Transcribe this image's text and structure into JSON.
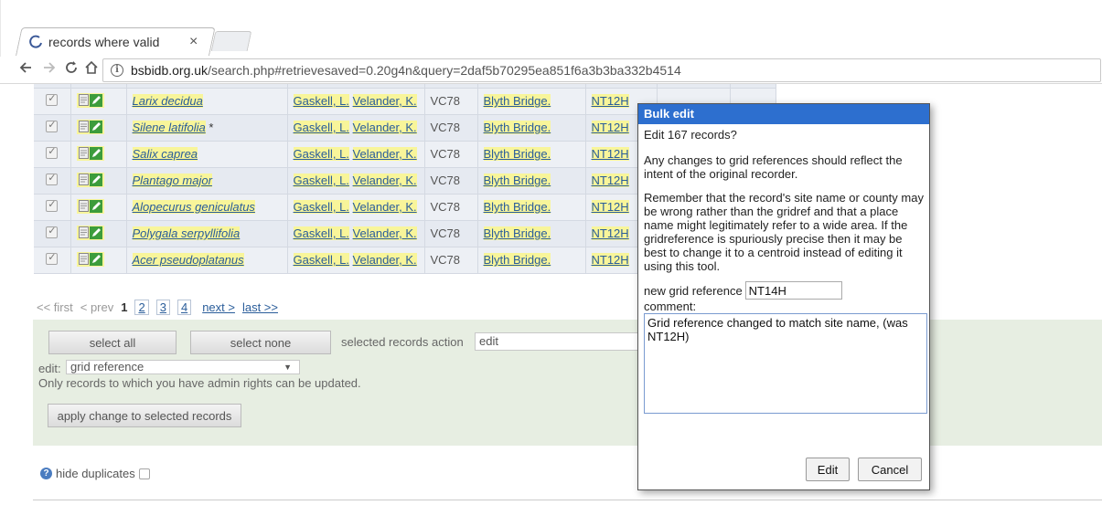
{
  "browser": {
    "tab_title": "records where valid",
    "tab_close": "×",
    "url_domain": "bsbidb.org.uk",
    "url_path": "/search.php#retrievesaved=0.20g4n&query=2daf5b70295ea851f6a3b3ba332b4514",
    "icons": {
      "back": "arrow-left",
      "forward": "arrow-right",
      "reload": "reload",
      "home": "home",
      "info": "info"
    }
  },
  "table": {
    "rows": [
      {
        "taxon": "Larix decidua",
        "marker": "",
        "recorder1": "Gaskell, L.",
        "recorder2": "Velander, K.",
        "vc": "VC78",
        "site": "Blyth Bridge.",
        "grid": "NT12H"
      },
      {
        "taxon": "Silene latifolia",
        "marker": "*",
        "recorder1": "Gaskell, L.",
        "recorder2": "Velander, K.",
        "vc": "VC78",
        "site": "Blyth Bridge.",
        "grid": "NT12H"
      },
      {
        "taxon": "Salix caprea",
        "marker": "",
        "recorder1": "Gaskell, L.",
        "recorder2": "Velander, K.",
        "vc": "VC78",
        "site": "Blyth Bridge.",
        "grid": "NT12H"
      },
      {
        "taxon": "Plantago major",
        "marker": "",
        "recorder1": "Gaskell, L.",
        "recorder2": "Velander, K.",
        "vc": "VC78",
        "site": "Blyth Bridge.",
        "grid": "NT12H"
      },
      {
        "taxon": "Alopecurus geniculatus",
        "marker": "",
        "recorder1": "Gaskell, L.",
        "recorder2": "Velander, K.",
        "vc": "VC78",
        "site": "Blyth Bridge.",
        "grid": "NT12H"
      },
      {
        "taxon": "Polygala serpyllifolia",
        "marker": "",
        "recorder1": "Gaskell, L.",
        "recorder2": "Velander, K.",
        "vc": "VC78",
        "site": "Blyth Bridge.",
        "grid": "NT12H"
      },
      {
        "taxon": "Acer pseudoplatanus",
        "marker": "",
        "recorder1": "Gaskell, L.",
        "recorder2": "Velander, K.",
        "vc": "VC78",
        "site": "Blyth Bridge.",
        "grid": "NT12H"
      }
    ]
  },
  "pager": {
    "first": "<< first",
    "prev": "< prev",
    "current": "1",
    "pages": [
      "2",
      "3",
      "4"
    ],
    "next": "next >",
    "last": "last >>"
  },
  "actions": {
    "select_all": "select all",
    "select_none": "select none",
    "selected_action_label": "selected records action",
    "selected_action_value": "edit",
    "edit_label": "edit:",
    "edit_value": "grid reference",
    "admin_note": "Only records to which you have admin rights can be updated.",
    "apply_button": "apply change to selected records"
  },
  "footer": {
    "hide_duplicates": "hide duplicates"
  },
  "dialog": {
    "title": "Bulk edit",
    "question": "Edit 167 records?",
    "para1": "Any changes to grid references should reflect the intent of the original recorder.",
    "para2": "Remember that the record's site name or county may be wrong rather than the gridref and that a place name might legitimately refer to a wide area. If the gridreference is spuriously precise then it may be best to change it to a centroid instead of editing it using this tool.",
    "grid_label": "new grid reference",
    "grid_value": "NT14H",
    "comment_label": "comment:",
    "comment_value": "Grid reference changed to match site name, (was NT12H)",
    "edit_button": "Edit",
    "cancel_button": "Cancel"
  },
  "colors": {
    "dialog_title_bar": "#2d6fcf",
    "link": "#2a5d9a",
    "highlight": "#f8f59a",
    "action_panel": "#e7eee2"
  }
}
